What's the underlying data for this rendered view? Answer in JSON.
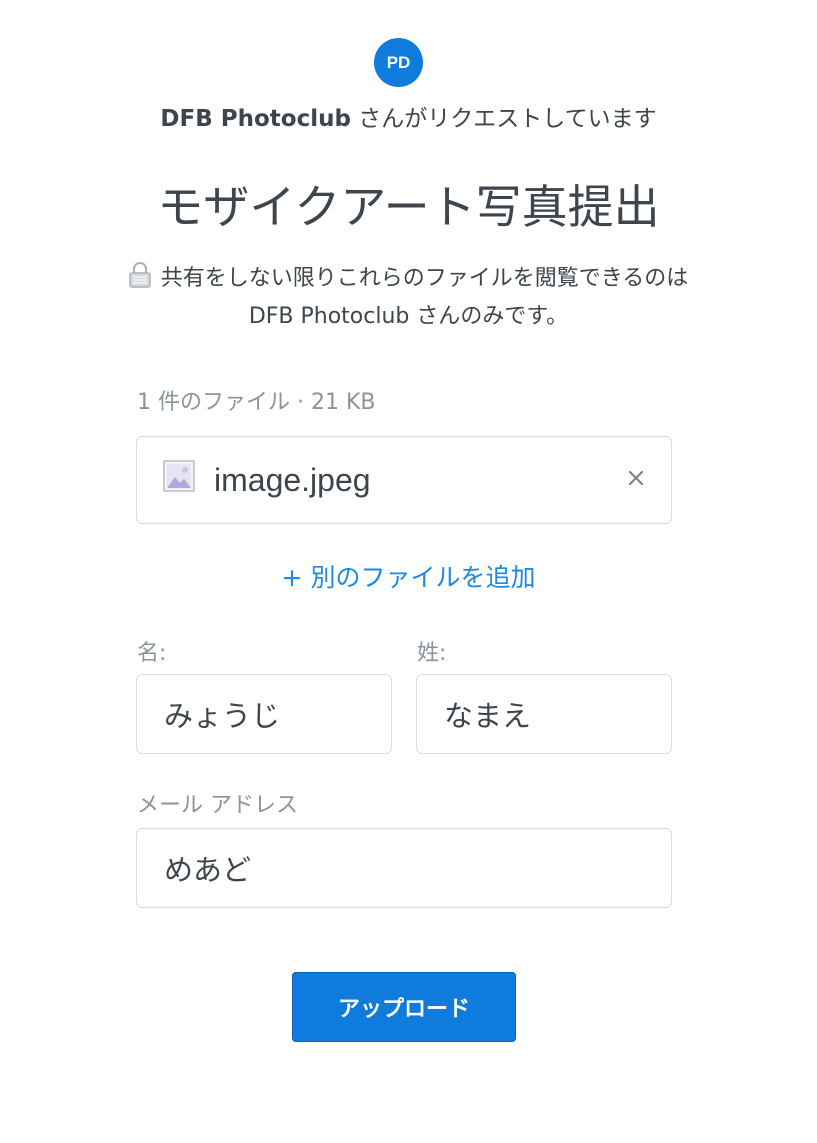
{
  "header": {
    "avatar_initials": "PD",
    "requester_name": "DFB Photoclub",
    "requester_suffix": " さんがリクエストしています",
    "title": "モザイクアート写真提出"
  },
  "privacy": {
    "icon": "lock-icon",
    "text": "共有をしない限りこれらのファイルを閲覧できるのは DFB Photoclub さんのみです。"
  },
  "files": {
    "summary": "1 件のファイル · 21 KB",
    "items": [
      {
        "name": "image.jpeg",
        "icon": "image-file-icon",
        "remove_icon": "close-icon"
      }
    ],
    "add_label": "+ 別のファイルを追加"
  },
  "form": {
    "first_name_label": "名:",
    "first_name_value": "みょうじ",
    "last_name_label": "姓:",
    "last_name_value": "なまえ",
    "email_label": "メール アドレス",
    "email_value": "めあど"
  },
  "submit": {
    "label": "アップロード"
  },
  "colors": {
    "accent": "#0f7cdd",
    "link": "#1e88e5",
    "text": "#3d464d",
    "muted": "#8a949c",
    "border": "#d8dde1"
  }
}
